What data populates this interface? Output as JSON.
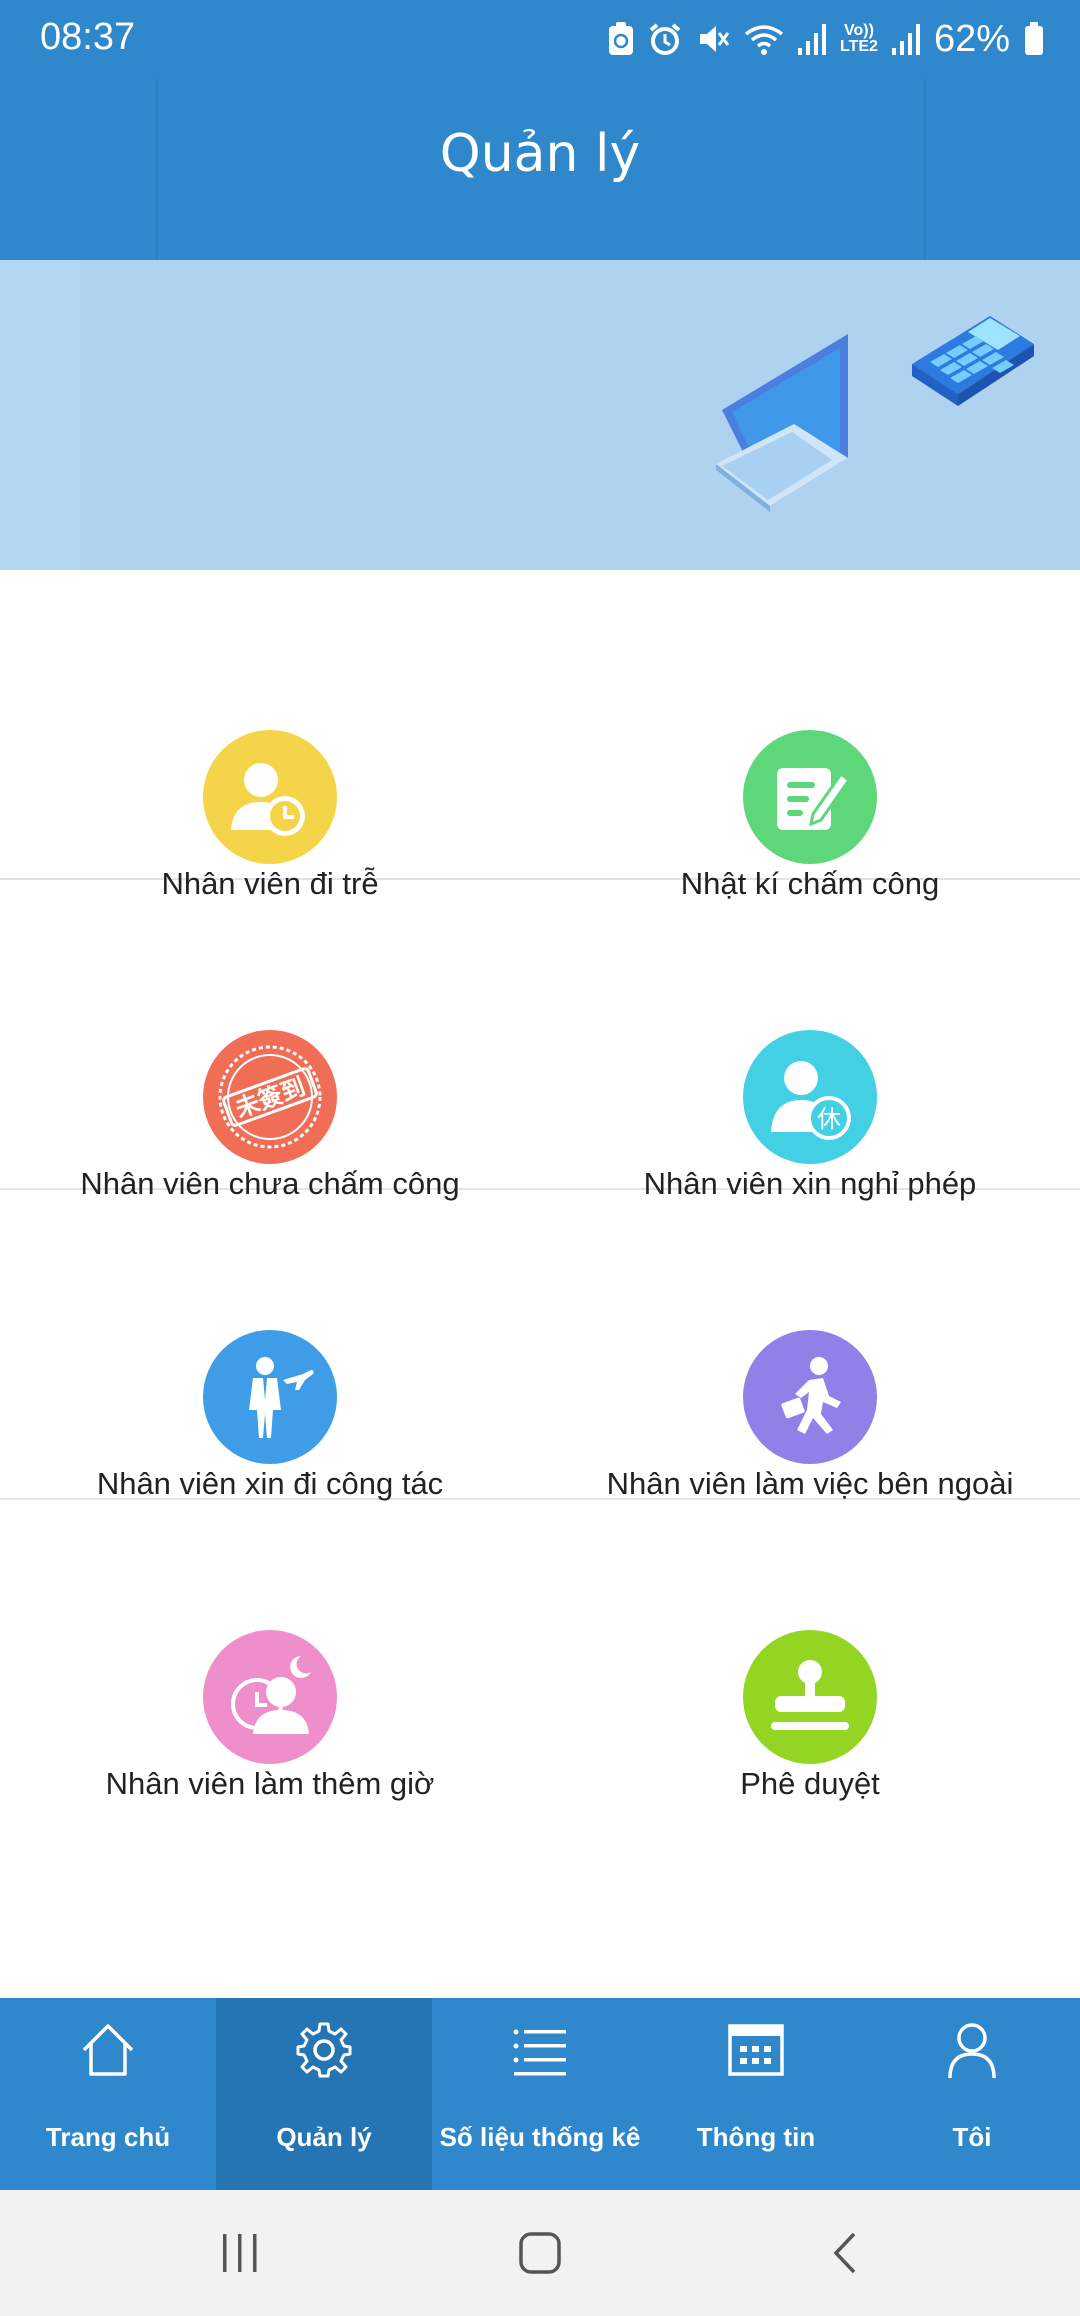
{
  "status_bar": {
    "time": "08:37",
    "battery_text": "62%",
    "icons": [
      "sync-icon",
      "alarm-icon",
      "mute-icon",
      "wifi-icon",
      "signal-icon",
      "volte-icon",
      "signal-icon",
      "battery-icon"
    ],
    "volte_top": "Vo))",
    "volte_bottom": "LTE2"
  },
  "header": {
    "title": "Quản lý"
  },
  "banner": {
    "illustration": [
      "laptop-illustration",
      "calculator-illustration"
    ]
  },
  "menu": {
    "items": [
      {
        "label": "Nhân viên đi trễ",
        "icon": "late-employee-icon",
        "color": "#f4d549"
      },
      {
        "label": "Nhật kí chấm công",
        "icon": "timesheet-log-icon",
        "color": "#5ed67a"
      },
      {
        "label": "Nhân viên chưa chấm công",
        "icon": "not-checked-in-stamp-icon",
        "color": "#f06e56",
        "stamp_text": "未簽到"
      },
      {
        "label": "Nhân viên xin nghỉ phép",
        "icon": "leave-request-icon",
        "color": "#43cfe4",
        "badge_text": "休"
      },
      {
        "label": "Nhân viên xin đi công tác",
        "icon": "business-trip-icon",
        "color": "#3f9ce6"
      },
      {
        "label": "Nhân viên làm việc bên ngoài",
        "icon": "field-work-icon",
        "color": "#8f81e8"
      },
      {
        "label": "Nhân viên làm thêm giờ",
        "icon": "overtime-icon",
        "color": "#ee8fcb"
      },
      {
        "label": "Phê duyệt",
        "icon": "approval-stamp-icon",
        "color": "#94d524"
      }
    ]
  },
  "tabbar": {
    "active": "Quản lý",
    "tabs": [
      {
        "label": "Trang chủ",
        "icon": "home-icon"
      },
      {
        "label": "Quản lý",
        "icon": "gear-icon"
      },
      {
        "label": "Số liệu thống kê",
        "icon": "list-icon"
      },
      {
        "label": "Thông tin",
        "icon": "calendar-icon"
      },
      {
        "label": "Tôi",
        "icon": "person-icon"
      }
    ]
  },
  "colors": {
    "primary": "#2f88cc",
    "active_tab": "#2575b4",
    "banner": "#afd2ef"
  }
}
